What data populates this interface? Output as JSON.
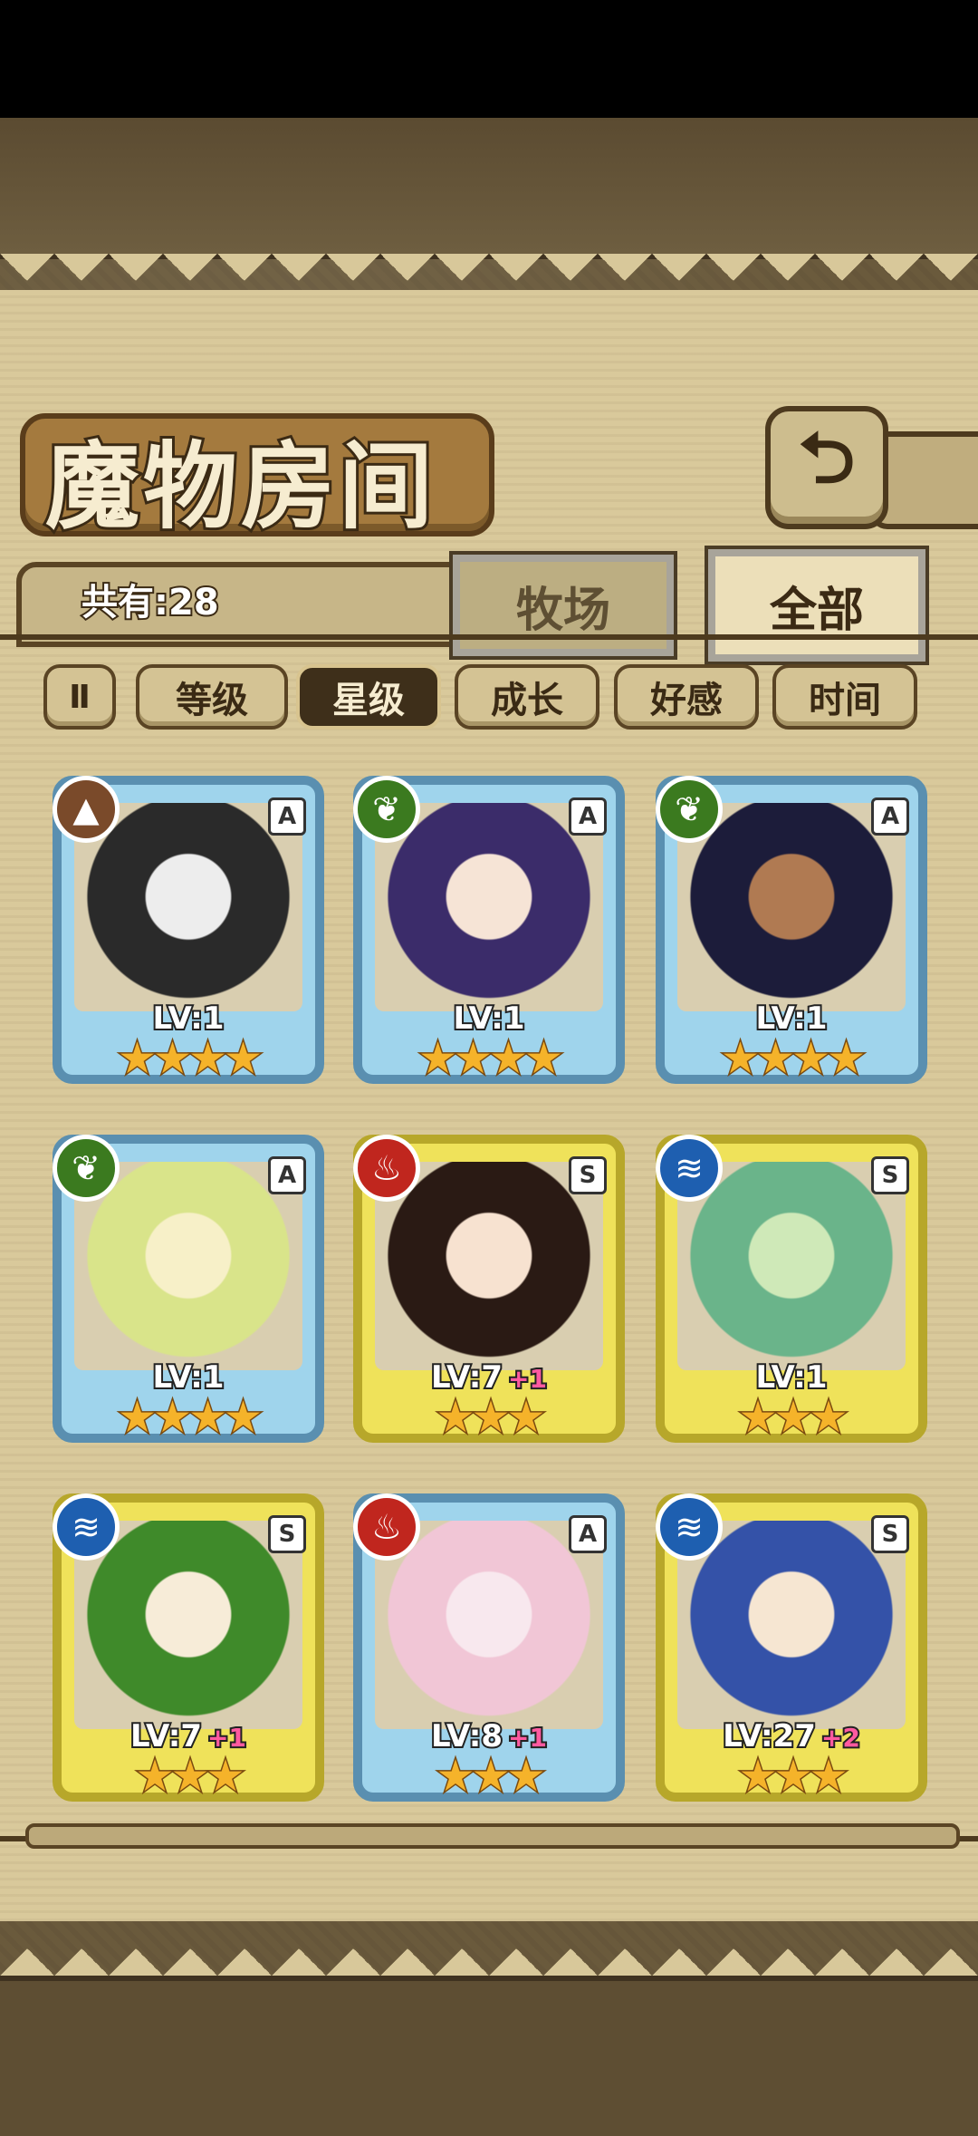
{
  "title": "魔物房间",
  "back_icon": "back-arrow-icon",
  "back_glyph": "⮌",
  "count_label": "共有:28",
  "tabs": {
    "ranch": "牧场",
    "all": "全部",
    "active": "all"
  },
  "sort": {
    "pause_glyph": "Ⅱ",
    "buttons": [
      "等级",
      "星级",
      "成长",
      "好感",
      "时间"
    ],
    "active_index": 1
  },
  "elements": {
    "earth": {
      "glyph": "▲",
      "color": "#7a4a2a"
    },
    "leaf": {
      "glyph": "❦",
      "color": "#3b7a1f"
    },
    "fire": {
      "glyph": "♨",
      "color": "#c0261e"
    },
    "water": {
      "glyph": "≋",
      "color": "#1e5fb0"
    }
  },
  "monsters": [
    {
      "element": "earth",
      "rank": "A",
      "level": "LV:1",
      "bonus": "",
      "stars": "★★★★",
      "skin": "#ededed",
      "hair": "#2a2a2a"
    },
    {
      "element": "leaf",
      "rank": "A",
      "level": "LV:1",
      "bonus": "",
      "stars": "★★★★",
      "skin": "#f6e4d6",
      "hair": "#3b2c6a"
    },
    {
      "element": "leaf",
      "rank": "A",
      "level": "LV:1",
      "bonus": "",
      "stars": "★★★★",
      "skin": "#b07a52",
      "hair": "#1c1c3a"
    },
    {
      "element": "leaf",
      "rank": "A",
      "level": "LV:1",
      "bonus": "",
      "stars": "★★★★",
      "skin": "#f7f0c8",
      "hair": "#d9e48a"
    },
    {
      "element": "fire",
      "rank": "S",
      "level": "LV:7",
      "bonus": "+1",
      "stars": "★★★",
      "skin": "#f7e2d0",
      "hair": "#2a1a14"
    },
    {
      "element": "water",
      "rank": "S",
      "level": "LV:1",
      "bonus": "",
      "stars": "★★★",
      "skin": "#cfe9b8",
      "hair": "#6ab48a"
    },
    {
      "element": "water",
      "rank": "S",
      "level": "LV:7",
      "bonus": "+1",
      "stars": "★★★",
      "skin": "#f7ecd8",
      "hair": "#3f8a2a"
    },
    {
      "element": "fire",
      "rank": "A",
      "level": "LV:8",
      "bonus": "+1",
      "stars": "★★★",
      "skin": "#f8e8ee",
      "hair": "#f1c6d6"
    },
    {
      "element": "water",
      "rank": "S",
      "level": "LV:27",
      "bonus": "+2",
      "stars": "★★★",
      "skin": "#f6e6d2",
      "hair": "#3452a8"
    }
  ]
}
